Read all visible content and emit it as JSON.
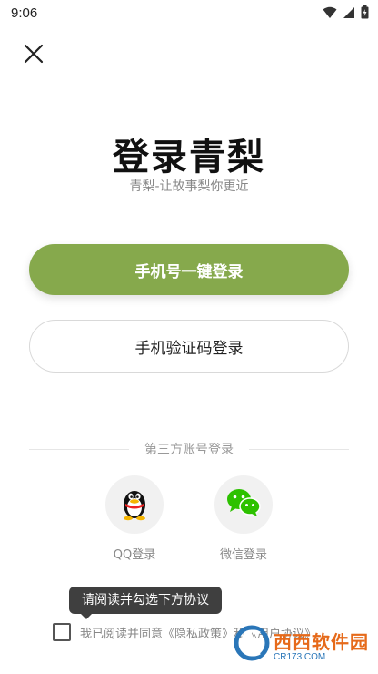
{
  "status_bar": {
    "time": "9:06"
  },
  "header": {
    "close_icon": "close-icon"
  },
  "title": "登录青梨",
  "subtitle": "青梨-让故事梨你更近",
  "buttons": {
    "one_click_login": "手机号一键登录",
    "sms_login": "手机验证码登录"
  },
  "colors": {
    "primary": "#86a94c",
    "wechat": "#2dc100",
    "text_muted": "#888888"
  },
  "third_party": {
    "heading": "第三方账号登录",
    "qq_label": "QQ登录",
    "wechat_label": "微信登录"
  },
  "tooltip": "请阅读并勾选下方协议",
  "agreement": {
    "checked": false,
    "prefix": "我已阅读并同意",
    "privacy": "《隐私政策》",
    "and": "和",
    "user_agreement": "《用户协议》"
  },
  "watermark": {
    "main": "西西软件园",
    "sub": "CR173.COM"
  }
}
